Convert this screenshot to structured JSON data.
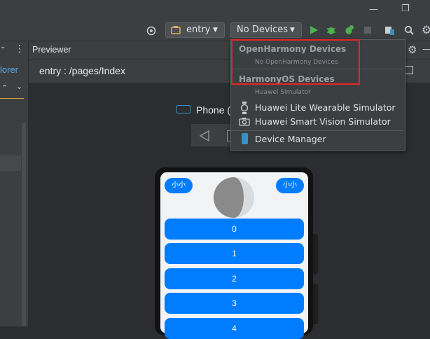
{
  "toolbar": {
    "module": "entry",
    "device": "No Devices"
  },
  "panel": {
    "title": "Previewer",
    "path": "entry : /pages/Index",
    "explorer_fragment": "lorer",
    "device_label": "Phone ("
  },
  "dropdown": {
    "group1": "OpenHarmony Devices",
    "group1_note": "No OpenHarmony Devices",
    "group2": "HarmonyOS Devices",
    "group2_note": "Huawei Simulator",
    "items": [
      "Huawei Lite Wearable Simulator",
      "Huawei Smart Vision Simulator"
    ],
    "manager": "Device Manager"
  },
  "app": {
    "left_button": "小小",
    "right_button": "小小",
    "list": [
      "0",
      "1",
      "2",
      "3",
      "4"
    ]
  },
  "colors": {
    "accent": "#007dff",
    "highlight": "#e5252a",
    "run_green": "#4caf50"
  }
}
